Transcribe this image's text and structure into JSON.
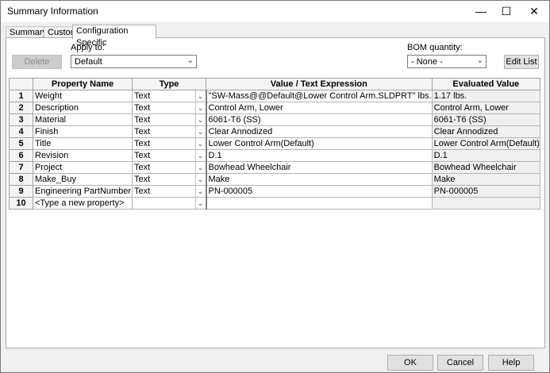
{
  "window": {
    "title": "Summary Information"
  },
  "controls": {
    "minimize": "—",
    "maximize": "☐",
    "close": "✕"
  },
  "tabs": [
    "Summary",
    "Custom",
    "Configuration Specific"
  ],
  "toolbar": {
    "delete_label": "Delete",
    "apply_to_label": "Apply to:",
    "apply_to_value": "Default",
    "bom_label": "BOM quantity:",
    "bom_value": "- None -",
    "edit_list_label": "Edit List"
  },
  "table": {
    "headers": [
      "Property Name",
      "Type",
      "Value / Text Expression",
      "Evaluated Value"
    ],
    "rows": [
      {
        "num": "1",
        "name": "Weight",
        "type": "Text",
        "value": "\"SW-Mass@@Default@Lower Control Arm.SLDPRT\" lbs.",
        "evaluated": "1.17 lbs."
      },
      {
        "num": "2",
        "name": "Description",
        "type": "Text",
        "value": "Control Arm, Lower",
        "evaluated": "Control Arm, Lower"
      },
      {
        "num": "3",
        "name": "Material",
        "type": "Text",
        "value": "6061-T6 (SS)",
        "evaluated": "6061-T6 (SS)"
      },
      {
        "num": "4",
        "name": "Finish",
        "type": "Text",
        "value": "Clear Annodized",
        "evaluated": "Clear Annodized"
      },
      {
        "num": "5",
        "name": "Title",
        "type": "Text",
        "value": "Lower Control Arm(Default)",
        "evaluated": "Lower Control Arm(Default)"
      },
      {
        "num": "6",
        "name": "Revision",
        "type": "Text",
        "value": "D.1",
        "evaluated": "D.1"
      },
      {
        "num": "7",
        "name": "Project",
        "type": "Text",
        "value": "Bowhead Wheelchair",
        "evaluated": "Bowhead Wheelchair"
      },
      {
        "num": "8",
        "name": "Make_Buy",
        "type": "Text",
        "value": "Make",
        "evaluated": "Make"
      },
      {
        "num": "9",
        "name": "Engineering PartNumber",
        "type": "Text",
        "value": "PN-000005",
        "evaluated": "PN-000005"
      },
      {
        "num": "10",
        "name": "<Type a new property>",
        "type": "",
        "value": "",
        "evaluated": ""
      }
    ]
  },
  "footer": {
    "ok": "OK",
    "cancel": "Cancel",
    "help": "Help"
  }
}
